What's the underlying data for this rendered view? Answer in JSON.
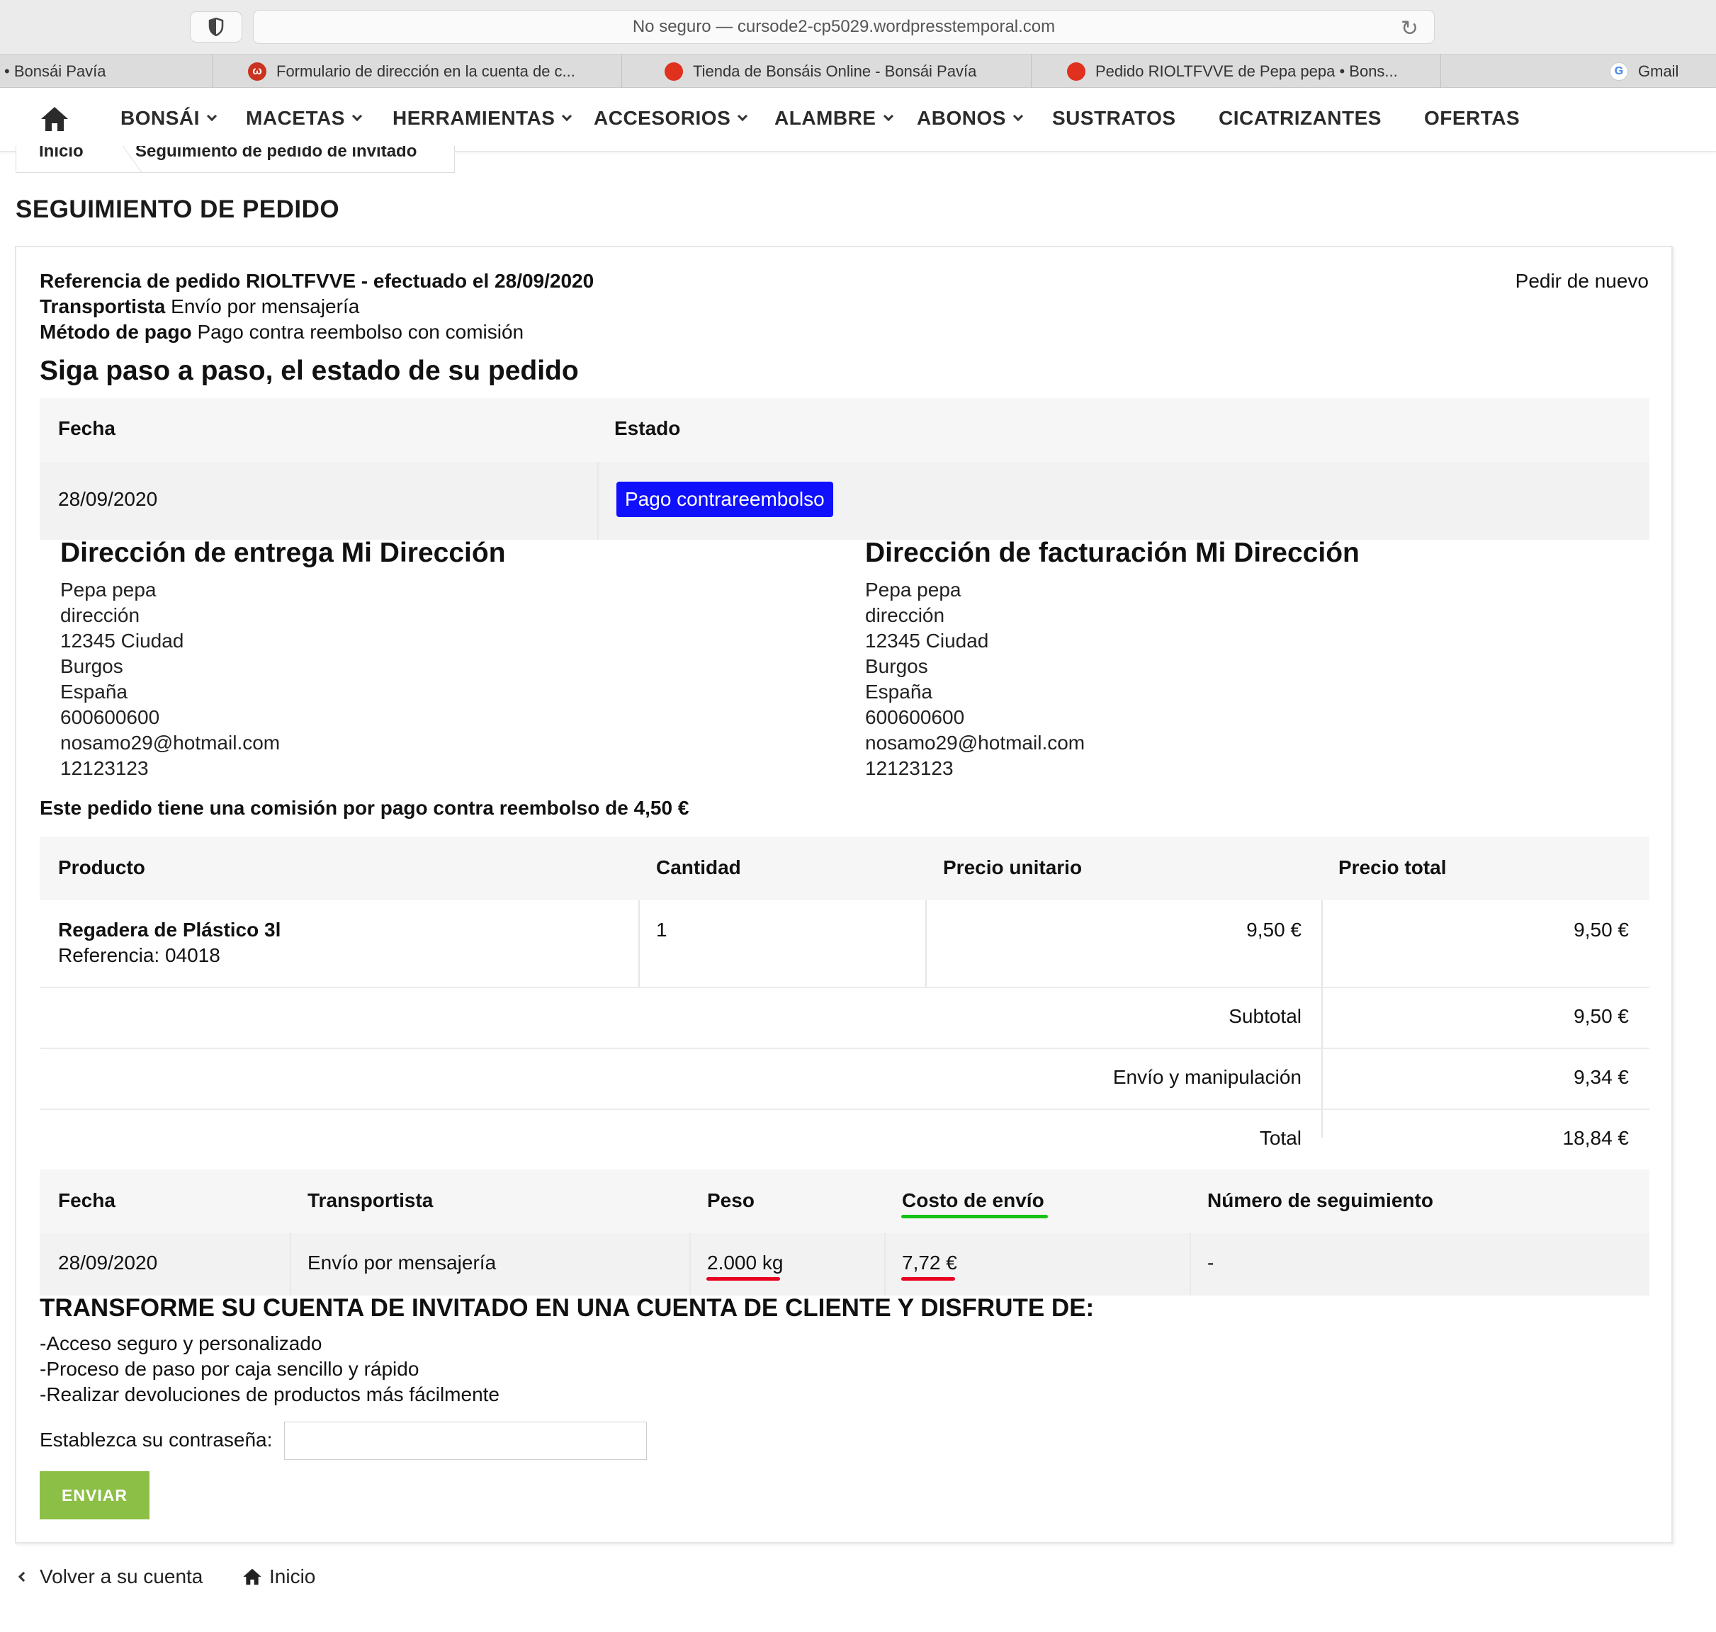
{
  "browser": {
    "address": "No seguro — cursode2-cp5029.wordpresstemporal.com",
    "tabs": [
      {
        "label": "• Bonsái Pavía"
      },
      {
        "label": "Formulario de dirección en la cuenta de c..."
      },
      {
        "label": "Tienda de Bonsáis Online - Bonsái Pavía"
      },
      {
        "label": "Pedido RIOLTFVVE de Pepa pepa • Bons..."
      },
      {
        "label": "Gmail"
      }
    ]
  },
  "nav": {
    "items": [
      "BONSÁI",
      "MACETAS",
      "HERRAMIENTAS",
      "ACCESORIOS",
      "ALAMBRE",
      "ABONOS",
      "SUSTRATOS",
      "CICATRIZANTES",
      "OFERTAS"
    ]
  },
  "breadcrumb": {
    "home": "Inicio",
    "current": "Seguimiento de pedido de invitado"
  },
  "page": {
    "title": "SEGUIMIENTO DE PEDIDO"
  },
  "order": {
    "reference_line": "Referencia de pedido RIOLTFVVE - efectuado el 28/09/2020",
    "reorder": "Pedir de nuevo",
    "carrier_label": "Transportista",
    "carrier_value": "Envío por mensajería",
    "payment_label": "Método de pago",
    "payment_value": "Pago contra reembolso con comisión"
  },
  "history": {
    "heading": "Siga paso a paso, el estado de su pedido",
    "col_date": "Fecha",
    "col_status": "Estado",
    "row_date": "28/09/2020",
    "row_status": "Pago contrareembolso",
    "status_color": "#1010ff"
  },
  "delivery": {
    "heading": "Dirección de entrega Mi Dirección",
    "lines": [
      "Pepa pepa",
      "dirección",
      "12345 Ciudad",
      "Burgos",
      "España",
      "600600600",
      "nosamo29@hotmail.com",
      "12123123"
    ]
  },
  "billing": {
    "heading": "Dirección de facturación Mi Dirección",
    "lines": [
      "Pepa pepa",
      "dirección",
      "12345 Ciudad",
      "Burgos",
      "España",
      "600600600",
      "nosamo29@hotmail.com",
      "12123123"
    ]
  },
  "commission_note": "Este pedido tiene una comisión por pago contra reembolso de 4,50 €",
  "products": {
    "col_product": "Producto",
    "col_qty": "Cantidad",
    "col_unit": "Precio unitario",
    "col_total": "Precio total",
    "row": {
      "name": "Regadera de Plástico 3l",
      "ref": "Referencia: 04018",
      "qty": "1",
      "unit": "9,50 €",
      "total": "9,50 €"
    },
    "subtotal_label": "Subtotal",
    "subtotal_value": "9,50 €",
    "shipping_label": "Envío y manipulación",
    "shipping_value": "9,34 €",
    "total_label": "Total",
    "total_value": "18,84 €"
  },
  "shipping": {
    "col_date": "Fecha",
    "col_carrier": "Transportista",
    "col_weight": "Peso",
    "col_cost": "Costo de envío",
    "col_tracking": "Número de seguimiento",
    "row_date": "28/09/2020",
    "row_carrier": "Envío por mensajería",
    "row_weight": "2.000 kg",
    "row_cost": "7,72 €",
    "row_tracking": "-"
  },
  "guest": {
    "heading": "TRANSFORME SU CUENTA DE INVITADO EN UNA CUENTA DE CLIENTE Y DISFRUTE DE:",
    "benefits": [
      "-Acceso seguro y personalizado",
      "-Proceso de paso por caja sencillo y rápido",
      "-Realizar devoluciones de productos más fácilmente"
    ],
    "password_label": "Establezca su contraseña:",
    "password_value": "",
    "submit": "ENVIAR"
  },
  "footer": {
    "back": "Volver a su cuenta",
    "home": "Inicio"
  },
  "colors": {
    "accent_green": "#8cbf45",
    "annotation_red": "#e8001e",
    "annotation_green": "#16c216"
  }
}
